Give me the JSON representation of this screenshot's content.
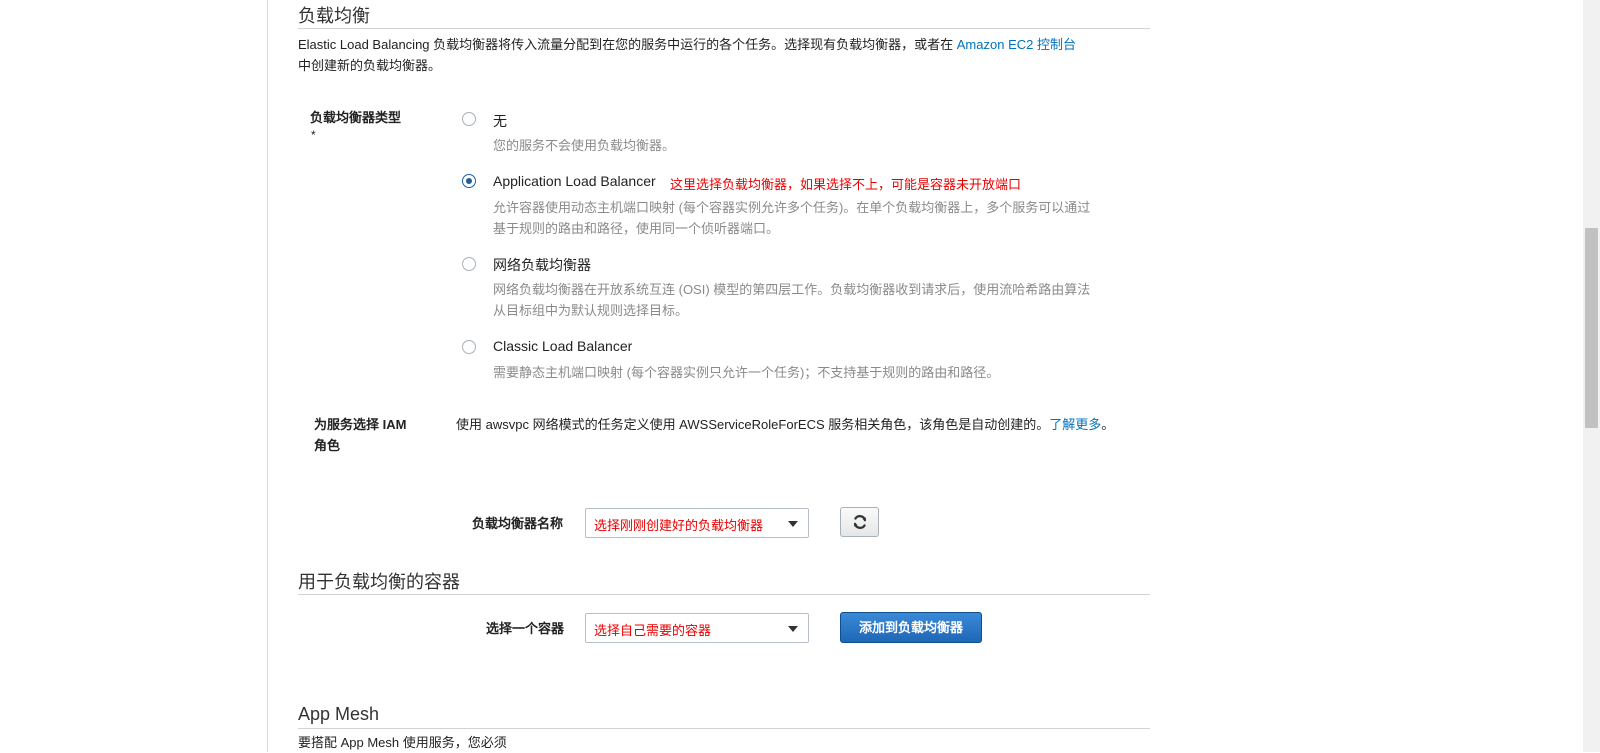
{
  "load_balancing": {
    "title": "负载均衡",
    "description_prefix": "Elastic Load Balancing 负载均衡器将传入流量分配到在您的服务中运行的各个任务。选择现有负载均衡器，或者在 ",
    "description_link": "Amazon EC2 控制台",
    "description_suffix": "中创建新的负载均衡器。",
    "type_label": "负载均衡器类型",
    "type_required_mark": "*",
    "options": [
      {
        "label": "无",
        "description": "您的服务不会使用负载均衡器。",
        "checked": false
      },
      {
        "label": "Application Load Balancer",
        "description": "允许容器使用动态主机端口映射 (每个容器实例允许多个任务)。在单个负载均衡器上，多个服务可以通过基于规则的路由和路径，使用同一个侦听器端口。",
        "checked": true
      },
      {
        "label": "网络负载均衡器",
        "description": "网络负载均衡器在开放系统互连 (OSI) 模型的第四层工作。负载均衡器收到请求后，使用流哈希路由算法从目标组中为默认规则选择目标。",
        "checked": false
      },
      {
        "label": "Classic Load Balancer",
        "description": "需要静态主机端口映射 (每个容器实例只允许一个任务)；不支持基于规则的路由和路径。",
        "checked": false
      }
    ],
    "annotation": "这里选择负载均衡器，如果选择不上，可能是容器未开放端口",
    "iam_label": "为服务选择 IAM 角色",
    "iam_text": "使用 awsvpc 网络模式的任务定义使用 AWSServiceRoleForECS 服务相关角色，该角色是自动创建的。",
    "iam_link": "了解更多",
    "iam_period": "。",
    "lb_name_label": "负载均衡器名称",
    "lb_name_value": "选择刚刚创建好的负载均衡器"
  },
  "container_section": {
    "title": "用于负载均衡的容器",
    "select_label": "选择一个容器",
    "select_value": "选择自己需要的容器",
    "add_button": "添加到负载均衡器"
  },
  "app_mesh": {
    "title": "App Mesh",
    "description": "要搭配 App Mesh 使用服务，您必须"
  },
  "icons": {
    "refresh": "refresh-icon",
    "dropdown": "chevron-down-icon"
  },
  "colors": {
    "link": "#0073bb",
    "annotation": "#e80000",
    "primary_button": "#1f66b6"
  }
}
